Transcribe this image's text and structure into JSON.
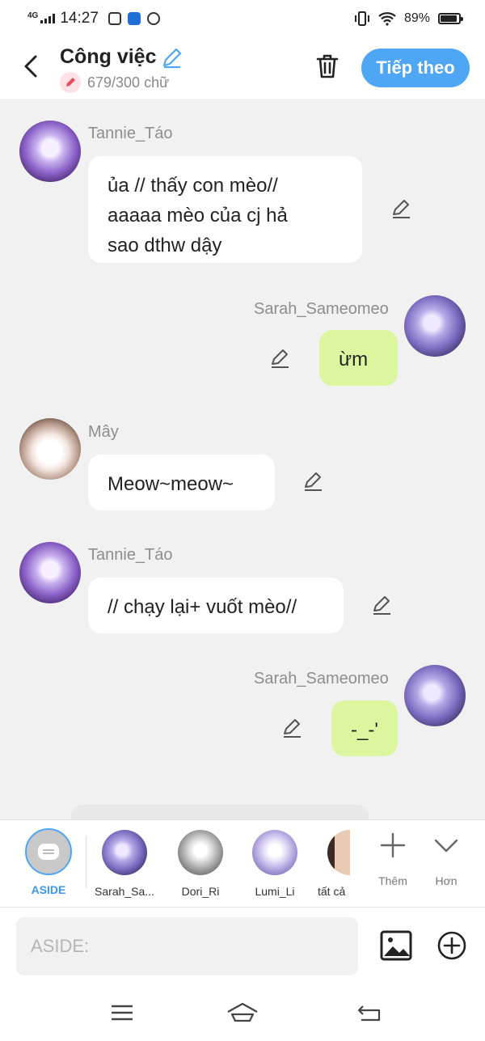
{
  "status_bar": {
    "network": "4G",
    "time": "14:27",
    "battery": "89%",
    "battery_level": 0.89,
    "notification_icons": [
      "zalo-icon",
      "zalo-pay-icon",
      "shield-app-icon"
    ]
  },
  "header": {
    "title": "Công việc",
    "word_count": "679/300 chữ",
    "next_label": "Tiếp theo"
  },
  "messages": [
    {
      "sender": "Tannie_Táo",
      "text": "ủa // thấy con mèo//\naaaaa mèo của cj hả\nsao dthw dậy",
      "side": "left",
      "bubble": "white"
    },
    {
      "sender": "Sarah_Sameomeo",
      "text": "ừm",
      "side": "right",
      "bubble": "green"
    },
    {
      "sender": "Mây",
      "text": "Meow~meow~",
      "side": "left",
      "bubble": "white"
    },
    {
      "sender": "Tannie_Táo",
      "text": "// chạy lại+ vuốt mèo//",
      "side": "left",
      "bubble": "white"
    },
    {
      "sender": "Sarah_Sameomeo",
      "text": "-_-'",
      "side": "right",
      "bubble": "green"
    }
  ],
  "character_bar": {
    "aside_label": "ASIDE",
    "characters": [
      "Sarah_Sa...",
      "Dori_Ri",
      "Lumi_Li",
      "tất cả"
    ],
    "add_label": "Thêm",
    "more_label": "Hơn"
  },
  "composer": {
    "placeholder": "ASIDE:"
  },
  "colors": {
    "accent": "#4ea6f5",
    "bubble_right": "#dcf6a0",
    "bubble_left": "#ffffff",
    "background": "#f1f1f1"
  }
}
